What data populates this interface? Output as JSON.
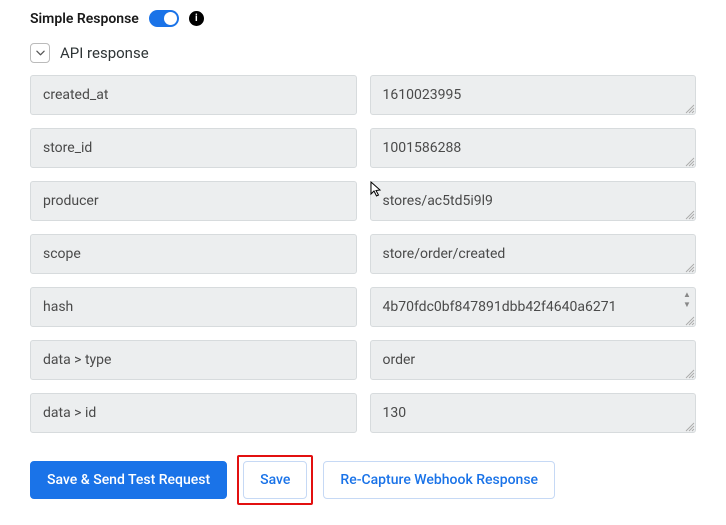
{
  "header": {
    "title": "Simple Response"
  },
  "section": {
    "title": "API response"
  },
  "fields": [
    {
      "key": "created_at",
      "value": "1610023995",
      "scrollable": false
    },
    {
      "key": "store_id",
      "value": "1001586288",
      "scrollable": false
    },
    {
      "key": "producer",
      "value": "stores/ac5td5i9l9",
      "scrollable": false
    },
    {
      "key": "scope",
      "value": "store/order/created",
      "scrollable": false
    },
    {
      "key": "hash",
      "value": "4b70fdc0bf847891dbb42f4640a6271",
      "scrollable": true
    },
    {
      "key": "data > type",
      "value": "order",
      "scrollable": false
    },
    {
      "key": "data > id",
      "value": "130",
      "scrollable": false
    }
  ],
  "buttons": {
    "save_send": "Save & Send Test Request",
    "save": "Save",
    "recapture": "Re-Capture Webhook Response"
  }
}
